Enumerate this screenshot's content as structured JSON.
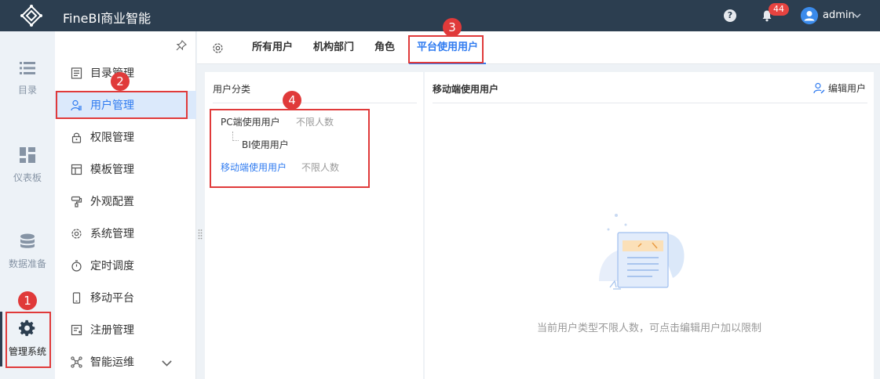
{
  "header": {
    "title": "FineBI商业智能",
    "notification_count": "44",
    "user": "admin",
    "help_icon": "question-icon",
    "bell_icon": "bell-icon"
  },
  "rail": {
    "items": [
      {
        "label": "目录",
        "icon": "list-icon"
      },
      {
        "label": "仪表板",
        "icon": "dashboard-icon"
      },
      {
        "label": "数据准备",
        "icon": "database-icon"
      },
      {
        "label": "管理系统",
        "icon": "gear-icon"
      }
    ]
  },
  "sidebar": {
    "items": [
      {
        "label": "目录管理",
        "icon": "catalog-icon"
      },
      {
        "label": "用户管理",
        "icon": "user-icon"
      },
      {
        "label": "权限管理",
        "icon": "lock-icon"
      },
      {
        "label": "模板管理",
        "icon": "template-icon"
      },
      {
        "label": "外观配置",
        "icon": "paint-icon"
      },
      {
        "label": "系统管理",
        "icon": "settings-icon"
      },
      {
        "label": "定时调度",
        "icon": "timer-icon"
      },
      {
        "label": "移动平台",
        "icon": "mobile-icon"
      },
      {
        "label": "注册管理",
        "icon": "register-icon"
      },
      {
        "label": "智能运维",
        "icon": "ops-icon"
      }
    ]
  },
  "tabs": [
    "所有用户",
    "机构部门",
    "角色",
    "平台使用用户"
  ],
  "left_panel": {
    "title": "用户分类",
    "rows": {
      "pc": {
        "label": "PC端使用用户",
        "limit": "不限人数"
      },
      "bi": {
        "label": "BI使用用户"
      },
      "mobile": {
        "label": "移动端使用用户",
        "limit": "不限人数"
      }
    }
  },
  "right_panel": {
    "title": "移动端使用用户",
    "edit_label": "编辑用户",
    "empty_message": "当前用户类型不限人数，可点击编辑用户加以限制"
  },
  "annotations": [
    "1",
    "2",
    "3",
    "4"
  ],
  "colors": {
    "accent": "#2f7bf0",
    "header": "#2c3e50",
    "annotation": "#e03a3a",
    "badge": "#e64340"
  }
}
